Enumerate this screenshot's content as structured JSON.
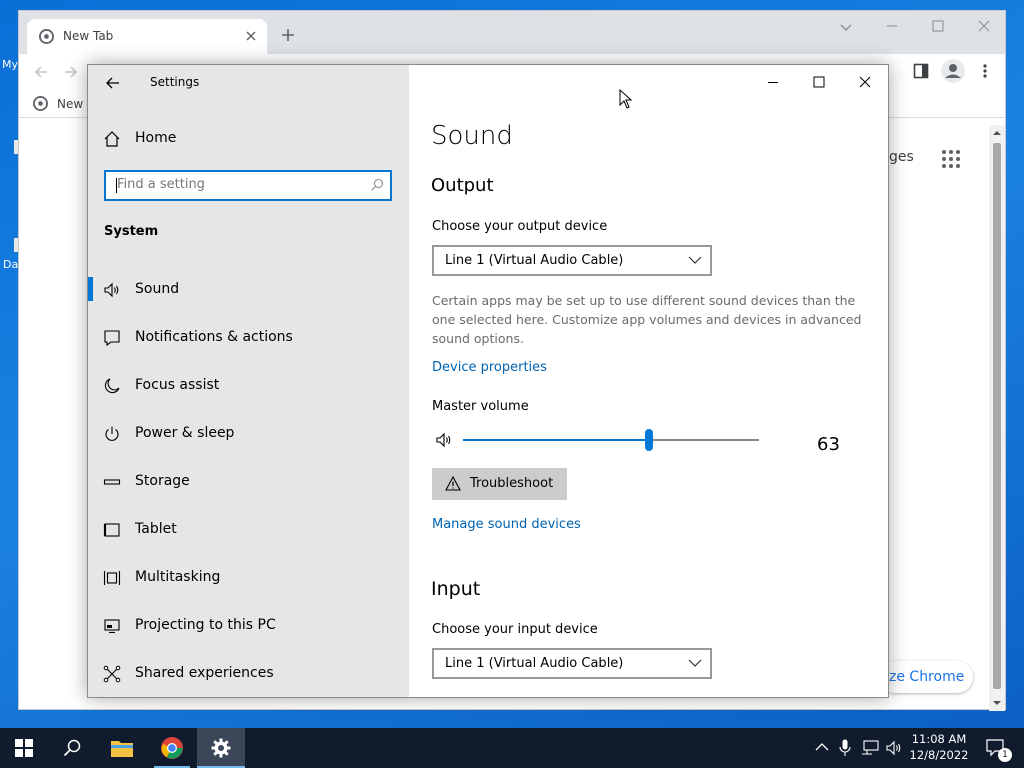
{
  "desktop": {
    "icon_labels": [
      "My",
      "Da"
    ]
  },
  "chrome": {
    "tab_title": "New Tab",
    "bookmark_label": "New T",
    "partial_text_right": "ges",
    "customize_label": "ze Chrome"
  },
  "settings": {
    "window_title": "Settings",
    "sidebar": {
      "home_label": "Home",
      "search_placeholder": "Find a setting",
      "section_header": "System",
      "items": [
        {
          "label": "Sound",
          "icon": "speaker-icon",
          "selected": true
        },
        {
          "label": "Notifications & actions",
          "icon": "notification-icon"
        },
        {
          "label": "Focus assist",
          "icon": "moon-icon"
        },
        {
          "label": "Power & sleep",
          "icon": "power-icon"
        },
        {
          "label": "Storage",
          "icon": "storage-icon"
        },
        {
          "label": "Tablet",
          "icon": "tablet-icon"
        },
        {
          "label": "Multitasking",
          "icon": "multitasking-icon"
        },
        {
          "label": "Projecting to this PC",
          "icon": "projecting-icon"
        },
        {
          "label": "Shared experiences",
          "icon": "shared-icon"
        }
      ]
    },
    "content": {
      "page_title": "Sound",
      "output_heading": "Output",
      "output_device_label": "Choose your output device",
      "output_device_value": "Line 1 (Virtual Audio Cable)",
      "info_text": "Certain apps may be set up to use different sound devices than the one selected here. Customize app volumes and devices in advanced sound options.",
      "device_properties_link": "Device properties",
      "master_volume_label": "Master volume",
      "master_volume_value": "63",
      "volume_fraction": 0.63,
      "troubleshoot_label": "Troubleshoot",
      "manage_devices_link": "Manage sound devices",
      "input_heading": "Input",
      "input_device_label": "Choose your input device",
      "input_device_value": "Line 1 (Virtual Audio Cable)"
    }
  },
  "taskbar": {
    "time": "11:08 AM",
    "date": "12/8/2022",
    "notification_count": "1"
  },
  "colors": {
    "accent": "#0078d7",
    "link": "#0063b1",
    "sidebar_bg": "#e6e6e6",
    "taskbar_bg": "#101b2d"
  }
}
